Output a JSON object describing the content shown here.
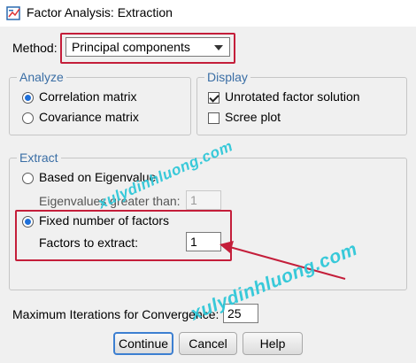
{
  "window": {
    "title": "Factor Analysis: Extraction"
  },
  "method": {
    "label": "Method:",
    "value": "Principal components"
  },
  "analyze": {
    "legend": "Analyze",
    "options": [
      "Correlation matrix",
      "Covariance matrix"
    ],
    "selected": "Correlation matrix"
  },
  "display": {
    "legend": "Display",
    "options": [
      {
        "label": "Unrotated factor solution",
        "checked": true
      },
      {
        "label": "Scree plot",
        "checked": false
      }
    ]
  },
  "extract": {
    "legend": "Extract",
    "based_on_eigenvalue": "Based on Eigenvalue",
    "eigen_label": "Eigenvalues greater than:",
    "eigen_value": "1",
    "fixed_number": "Fixed number of factors",
    "factors_label": "Factors to extract:",
    "factors_value": "1",
    "selected": "Fixed number of factors"
  },
  "max_iter": {
    "label": "Maximum Iterations for Convergence:",
    "value": "25"
  },
  "buttons": {
    "continue": "Continue",
    "cancel": "Cancel",
    "help": "Help"
  },
  "watermark": "xulydinhluong.com",
  "colors": {
    "highlight": "#c41e3a",
    "legend": "#3a6ea5",
    "watermark": "#2fc7d8",
    "default_button_border": "#3c7fd1"
  }
}
